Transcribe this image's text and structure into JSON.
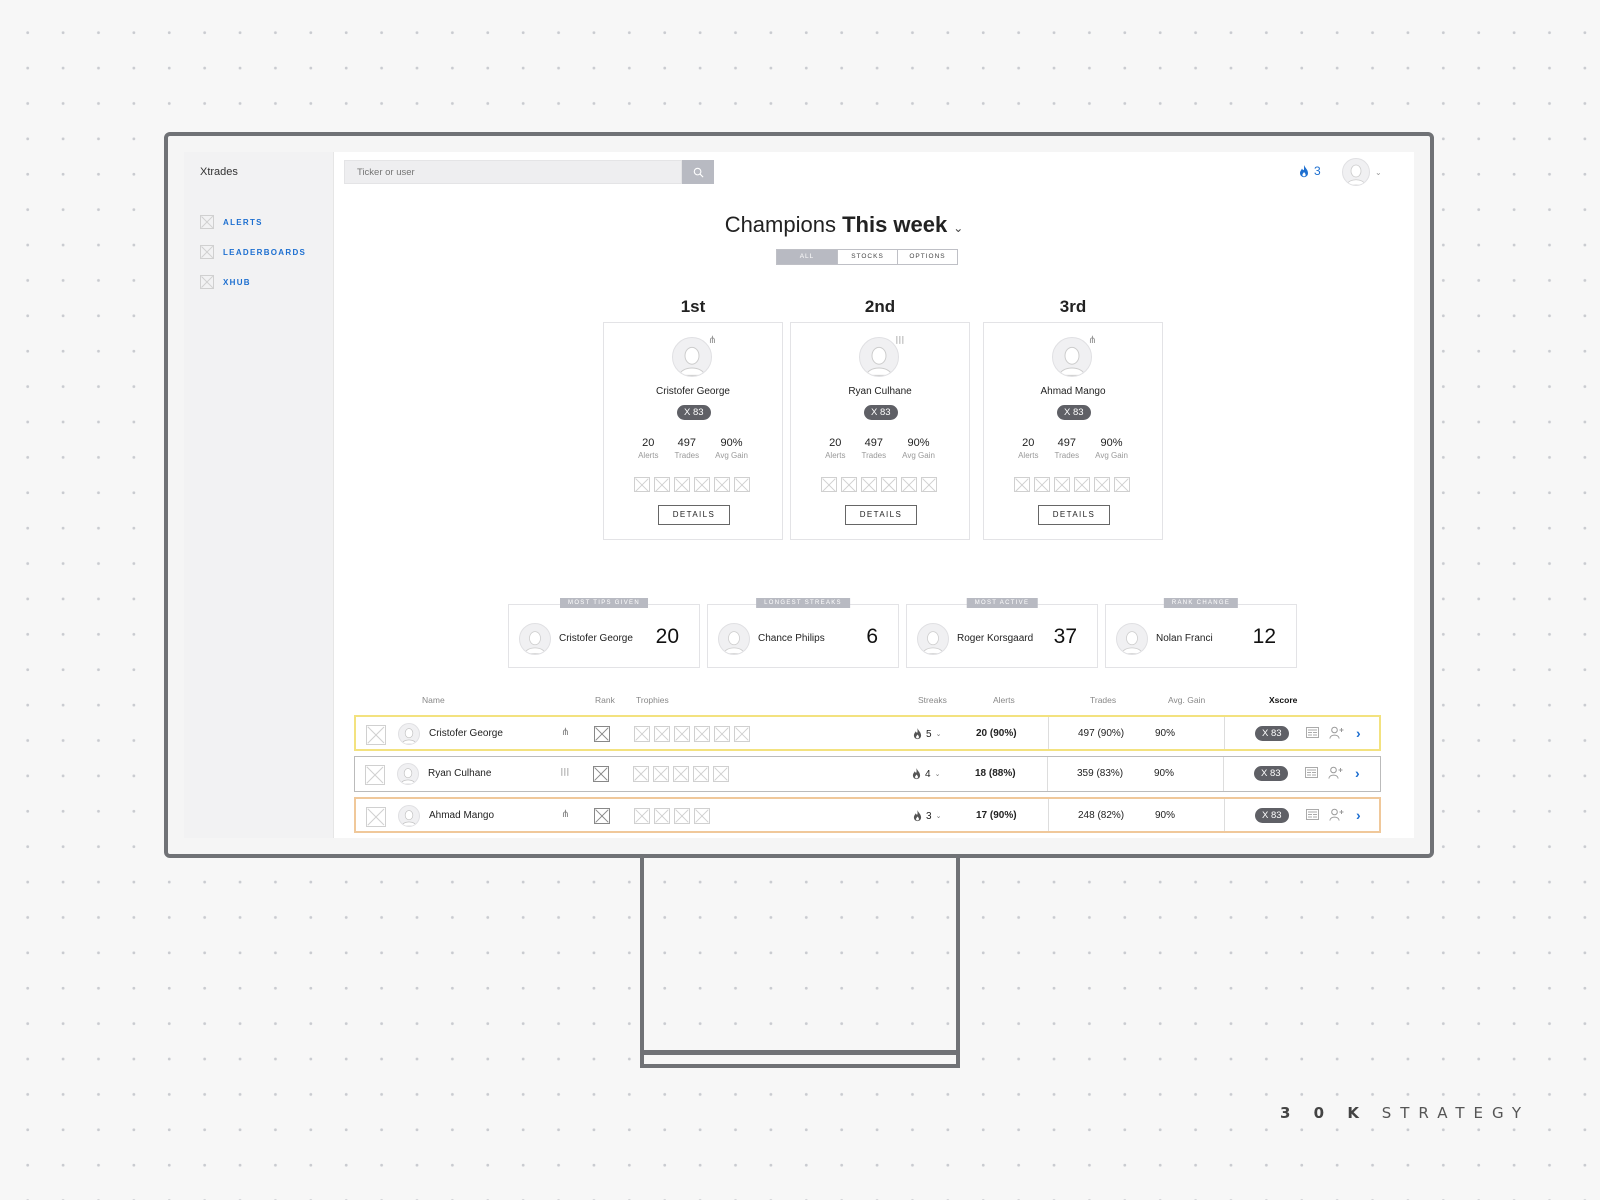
{
  "app": {
    "name": "Xtrades"
  },
  "sidebar": {
    "items": [
      {
        "label": "ALERTS"
      },
      {
        "label": "LEADERBOARDS"
      },
      {
        "label": "XHUB"
      }
    ]
  },
  "header": {
    "search_placeholder": "Ticker or user",
    "streak_count": "3"
  },
  "title": {
    "prefix": "Champions",
    "period": "This week"
  },
  "filter_tabs": [
    {
      "label": "ALL",
      "selected": true
    },
    {
      "label": "STOCKS"
    },
    {
      "label": "OPTIONS"
    }
  ],
  "podium": [
    {
      "place": "1st",
      "name": "Cristofer George",
      "xscore": "X 83",
      "alerts": "20",
      "alerts_label": "Alerts",
      "trades": "497",
      "trades_label": "Trades",
      "gain": "90%",
      "gain_label": "Avg Gain",
      "button": "DETAILS",
      "mark_icon": "satellite-icon"
    },
    {
      "place": "2nd",
      "name": "Ryan Culhane",
      "xscore": "X 83",
      "alerts": "20",
      "alerts_label": "Alerts",
      "trades": "497",
      "trades_label": "Trades",
      "gain": "90%",
      "gain_label": "Avg Gain",
      "button": "DETAILS",
      "mark_icon": "waveform-icon"
    },
    {
      "place": "3rd",
      "name": "Ahmad Mango",
      "xscore": "X 83",
      "alerts": "20",
      "alerts_label": "Alerts",
      "trades": "497",
      "trades_label": "Trades",
      "gain": "90%",
      "gain_label": "Avg Gain",
      "button": "DETAILS",
      "mark_icon": "satellite-icon"
    }
  ],
  "highlights": [
    {
      "tag": "MOST TIPS GIVEN",
      "name": "Cristofer George",
      "value": "20"
    },
    {
      "tag": "LONGEST STREAKS",
      "name": "Chance Philips",
      "value": "6"
    },
    {
      "tag": "MOST ACTIVE",
      "name": "Roger Korsgaard",
      "value": "37"
    },
    {
      "tag": "RANK CHANGE",
      "name": "Nolan Franci",
      "value": "12"
    }
  ],
  "table": {
    "columns": {
      "name": "Name",
      "rank": "Rank",
      "trophies": "Trophies",
      "streaks": "Streaks",
      "alerts": "Alerts",
      "trades": "Trades",
      "gain": "Avg. Gain",
      "xscore": "Xscore"
    },
    "rows": [
      {
        "name": "Cristofer George",
        "mark_icon": "satellite-icon",
        "trophies": 6,
        "streak": "5",
        "alerts": "20 (90%)",
        "trades": "497 (90%)",
        "gain": "90%",
        "xscore": "X 83",
        "highlight": "gold"
      },
      {
        "name": "Ryan Culhane",
        "mark_icon": "waveform-icon",
        "trophies": 5,
        "streak": "4",
        "alerts": "18 (88%)",
        "trades": "359 (83%)",
        "gain": "90%",
        "xscore": "X 83",
        "highlight": "none"
      },
      {
        "name": "Ahmad Mango",
        "mark_icon": "satellite-icon",
        "trophies": 4,
        "streak": "3",
        "alerts": "17 (90%)",
        "trades": "248 (82%)",
        "gain": "90%",
        "xscore": "X 83",
        "highlight": "bronze"
      }
    ]
  },
  "brand": {
    "bold": "3 0 K",
    "rest": "STRATEGY"
  },
  "colors": {
    "accent": "#1d6fd0",
    "pill": "#5f6066",
    "tag": "#b8bac2",
    "gold": "#f3e27f",
    "bronze": "#f0c89a"
  }
}
